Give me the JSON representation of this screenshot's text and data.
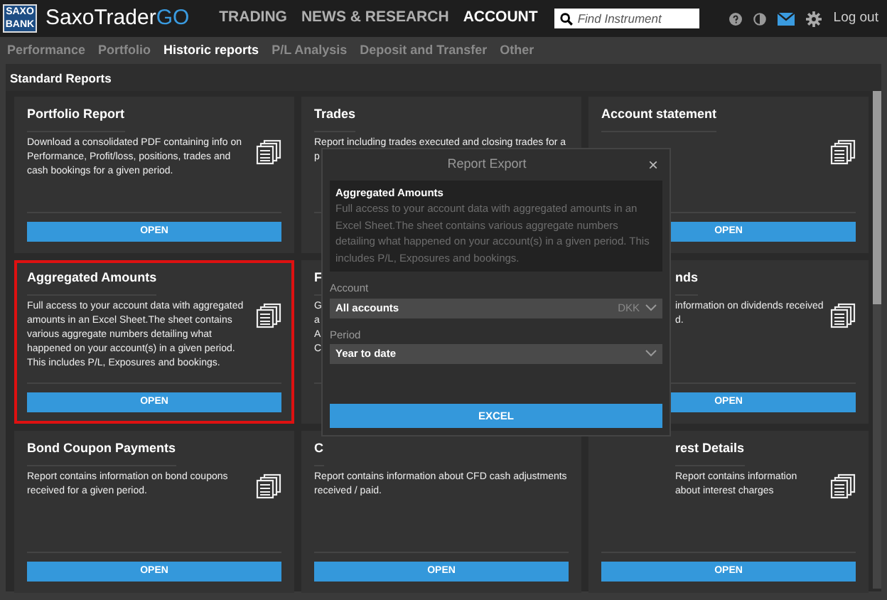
{
  "logo": {
    "line1": "SAXO",
    "line2": "BANK",
    "name_main": "SaxoTrader",
    "name_accent": "GO"
  },
  "main_nav": [
    {
      "label": "TRADING",
      "selected": false
    },
    {
      "label": "NEWS & RESEARCH",
      "selected": false
    },
    {
      "label": "ACCOUNT",
      "selected": true
    }
  ],
  "search": {
    "placeholder": "Find Instrument"
  },
  "logout": "Log out",
  "sub_nav": [
    {
      "label": "Performance",
      "selected": false
    },
    {
      "label": "Portfolio",
      "selected": false
    },
    {
      "label": "Historic reports",
      "selected": true
    },
    {
      "label": "P/L Analysis",
      "selected": false
    },
    {
      "label": "Deposit and Transfer",
      "selected": false
    },
    {
      "label": "Other",
      "selected": false
    }
  ],
  "section_title": "Standard Reports",
  "cards": [
    {
      "title": "Portfolio Report",
      "description": "Download a consolidated PDF containing info on Performance, Profit/loss, positions, trades and cash bookings for a given period.",
      "button": "OPEN",
      "highlighted": false
    },
    {
      "title": "Trades",
      "description_lines": [
        "Report including trades executed and closing trades for a",
        "p"
      ],
      "highlighted": false
    },
    {
      "title": "Account statement",
      "button": "OPEN",
      "highlighted": false
    },
    {
      "title": "Aggregated Amounts",
      "description": "Full access to your account data with aggregated amounts in an Excel Sheet.The sheet contains various aggregate numbers detailing what happened on your account(s) in a given period. This includes P/L, Exposures and bookings.",
      "button": "OPEN",
      "highlighted": true
    },
    {
      "title": "F",
      "description_lines": [
        "G",
        "a",
        "A",
        "C"
      ],
      "highlighted": false
    },
    {
      "title": "nds",
      "description_lines": [
        "information on dividends received",
        "d."
      ],
      "button": "OPEN",
      "highlighted": false
    },
    {
      "title": "Bond Coupon Payments",
      "description": "Report contains information on bond coupons received for a given period.",
      "button": "OPEN",
      "highlighted": false
    },
    {
      "title": "C",
      "description": "Report contains information about CFD cash adjustments received / paid.",
      "button": "OPEN",
      "highlighted": false
    },
    {
      "title": "rest Details",
      "description": "Report contains information about interest charges",
      "button": "OPEN",
      "highlighted": false
    }
  ],
  "modal": {
    "title": "Report Export",
    "close": "×",
    "info_title": "Aggregated Amounts",
    "info_text": "Full access to your account data with aggregated amounts in an Excel Sheet.The sheet contains various aggregate numbers detailing what happened on your account(s) in a given period. This includes P/L, Exposures and bookings.",
    "account_label": "Account",
    "account_value": "All accounts",
    "account_currency": "DKK",
    "period_label": "Period",
    "period_value": "Year to date",
    "button": "EXCEL"
  }
}
